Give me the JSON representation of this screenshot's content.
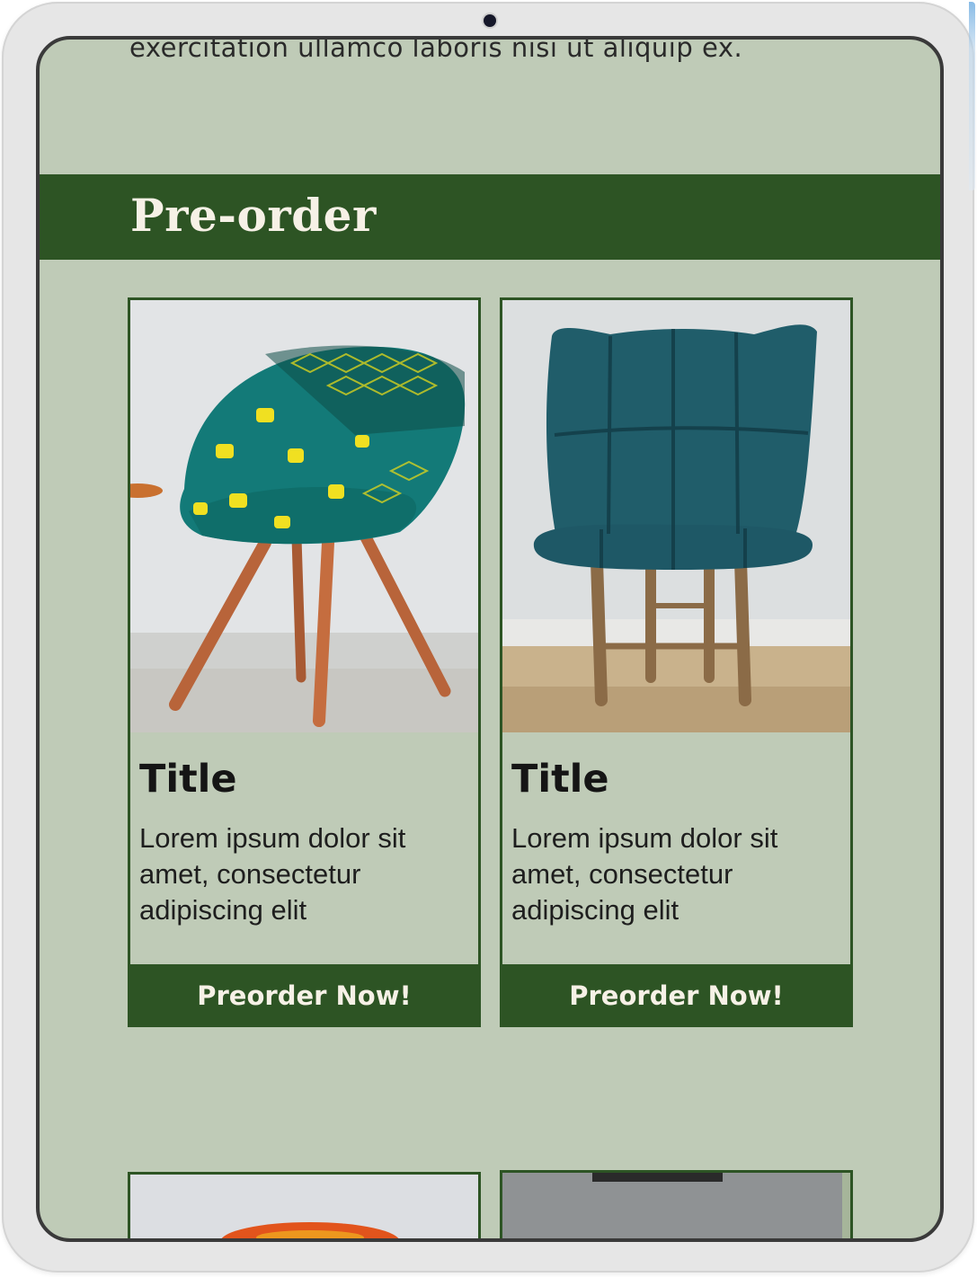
{
  "intro": {
    "text": "exercitation ullamco laboris nisi ut aliquip ex."
  },
  "section": {
    "title": "Pre-order"
  },
  "products": [
    {
      "image_icon": "patterned-armchair-image",
      "title": "Title",
      "description": "Lorem ipsum dolor sit amet, consectetur adipiscing elit",
      "button": "Preorder Now!"
    },
    {
      "image_icon": "quilted-teal-chair-image",
      "title": "Title",
      "description": "Lorem ipsum dolor sit amet, consectetur adipiscing elit",
      "button": "Preorder Now!"
    }
  ],
  "colors": {
    "screen_bg": "#bfcbb7",
    "accent": "#2d5424",
    "button_text": "#f6f1e6"
  }
}
